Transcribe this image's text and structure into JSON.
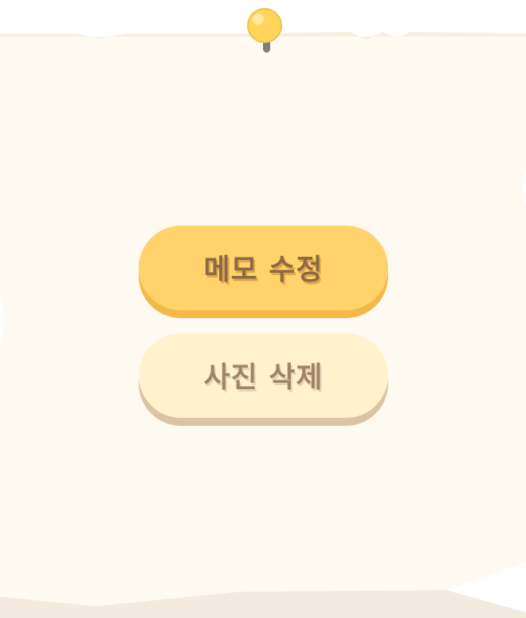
{
  "colors": {
    "paper": "#fffaf1",
    "paper_edge": "#f3ebdf",
    "edit_button": "#ffd36b",
    "edit_button_shadow": "#f5b94b",
    "delete_button": "#fff2cc",
    "delete_button_shadow": "#dcc3a3",
    "pin": "#ffd55c"
  },
  "icons": {
    "pin": "pushpin-icon"
  },
  "menu": {
    "edit_label": "메모 수정",
    "delete_label": "사진 삭제"
  }
}
